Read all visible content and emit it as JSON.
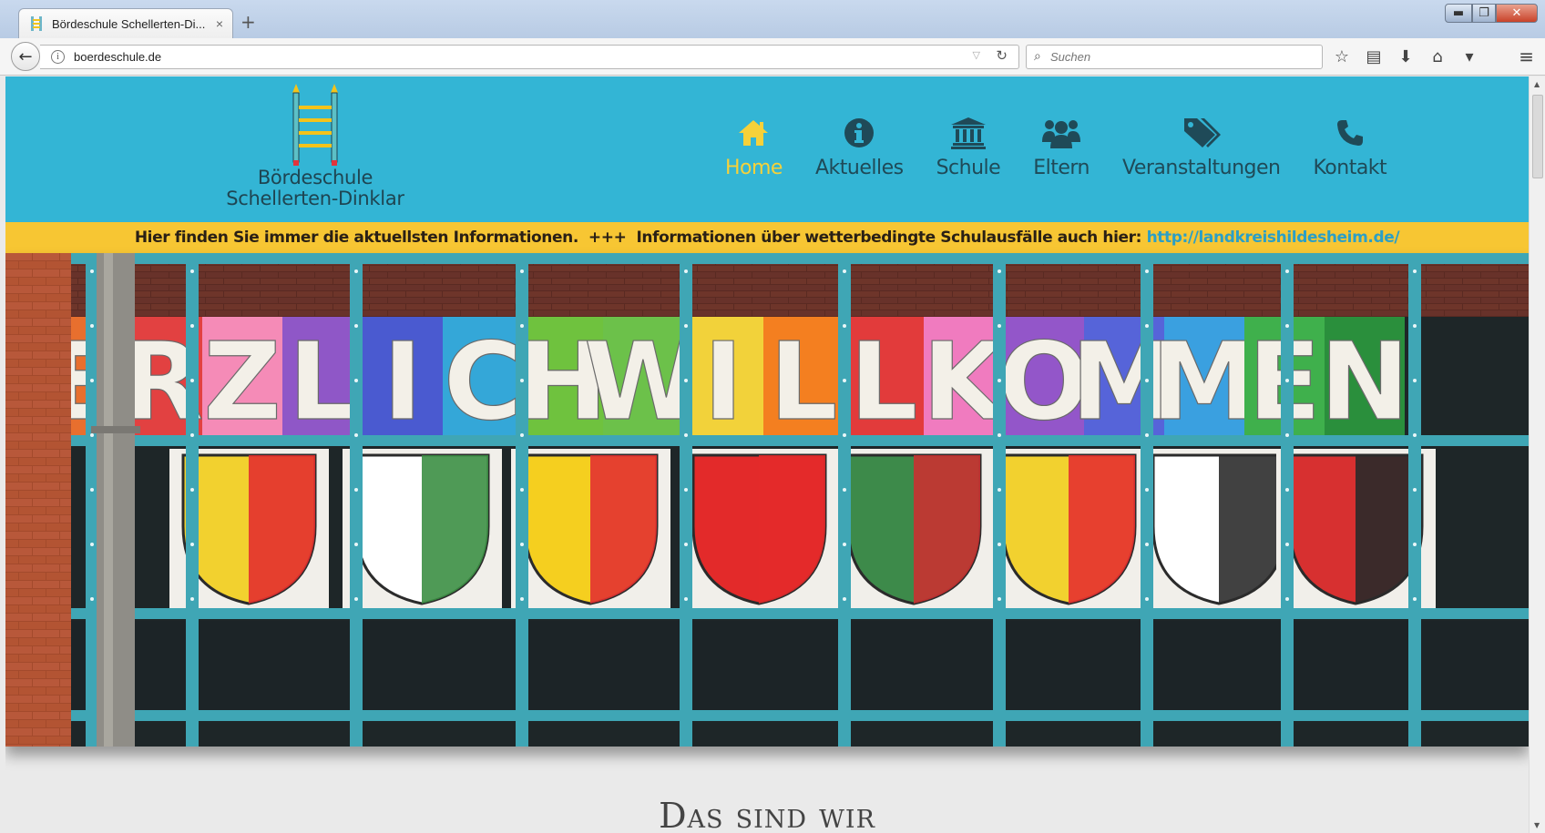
{
  "browser": {
    "tab_title": "Bördeschule Schellerten-Di...",
    "tab_close": "×",
    "new_tab": "+",
    "url": "boerdeschule.de",
    "search_placeholder": "Suchen",
    "window": {
      "minimize": "▬",
      "maximize": "❐",
      "close": "✕"
    },
    "toolbar_icons": [
      "bookmark-star-icon",
      "reading-list-icon",
      "download-icon",
      "home-icon",
      "pocket-icon"
    ],
    "menu_icon": "hamburger-menu-icon"
  },
  "site": {
    "logo": {
      "line1": "Bördeschule",
      "line2": "Schellerten-Dinklar"
    },
    "nav": [
      {
        "label": "Home",
        "icon": "home-icon",
        "active": true
      },
      {
        "label": "Aktuelles",
        "icon": "info-circle-icon",
        "active": false
      },
      {
        "label": "Schule",
        "icon": "institution-icon",
        "active": false
      },
      {
        "label": "Eltern",
        "icon": "users-icon",
        "active": false
      },
      {
        "label": "Veranstaltungen",
        "icon": "tags-icon",
        "active": false
      },
      {
        "label": "Kontakt",
        "icon": "phone-icon",
        "active": false
      }
    ],
    "ticker": {
      "text": "Hier finden Sie immer die aktuellsten Informationen.  +++  Informationen über wetterbedingte Schulausfälle auch hier: ",
      "link": "http://landkreishildesheim.de/"
    },
    "hero": {
      "banner_letters": [
        "E",
        "R",
        "Z",
        "L",
        "I",
        "C",
        "H",
        "W",
        "I",
        "L",
        "L",
        "K",
        "O",
        "M",
        "M",
        "E",
        "N"
      ]
    },
    "section_title": "Das sind wir"
  },
  "colors": {
    "header_bg": "#33b5d5",
    "nav_text": "#1f4a58",
    "nav_active": "#f6d13a",
    "ticker_bg": "#f7c633",
    "link": "#2b9fc6",
    "frame": "#3fa6b5"
  }
}
